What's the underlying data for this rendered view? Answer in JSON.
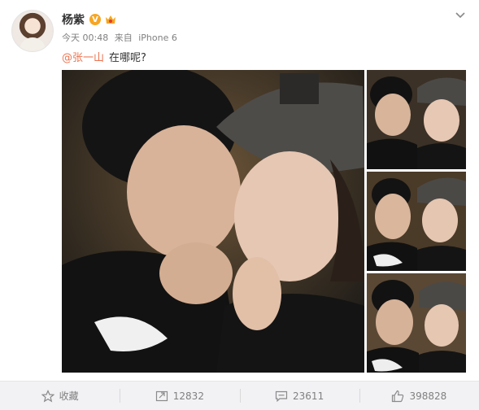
{
  "post": {
    "user_name": "杨紫",
    "verified_mark": "V",
    "time": "今天 00:48",
    "source_prefix": "来自",
    "source_device": "iPhone 6",
    "mention": "@张一山",
    "text": "在哪呢?"
  },
  "actions": {
    "favorite_label": "收藏",
    "repost_count": "12832",
    "comment_count": "23611",
    "like_count": "398828"
  },
  "colors": {
    "accent_orange": "#eb7350",
    "verified_gold": "#f6a623",
    "meta_gray": "#808080"
  },
  "icons": {
    "favorite": "star-icon",
    "repost": "repost-icon",
    "comment": "comment-icon",
    "like": "thumbs-up-icon",
    "menu": "chevron-down-icon"
  }
}
